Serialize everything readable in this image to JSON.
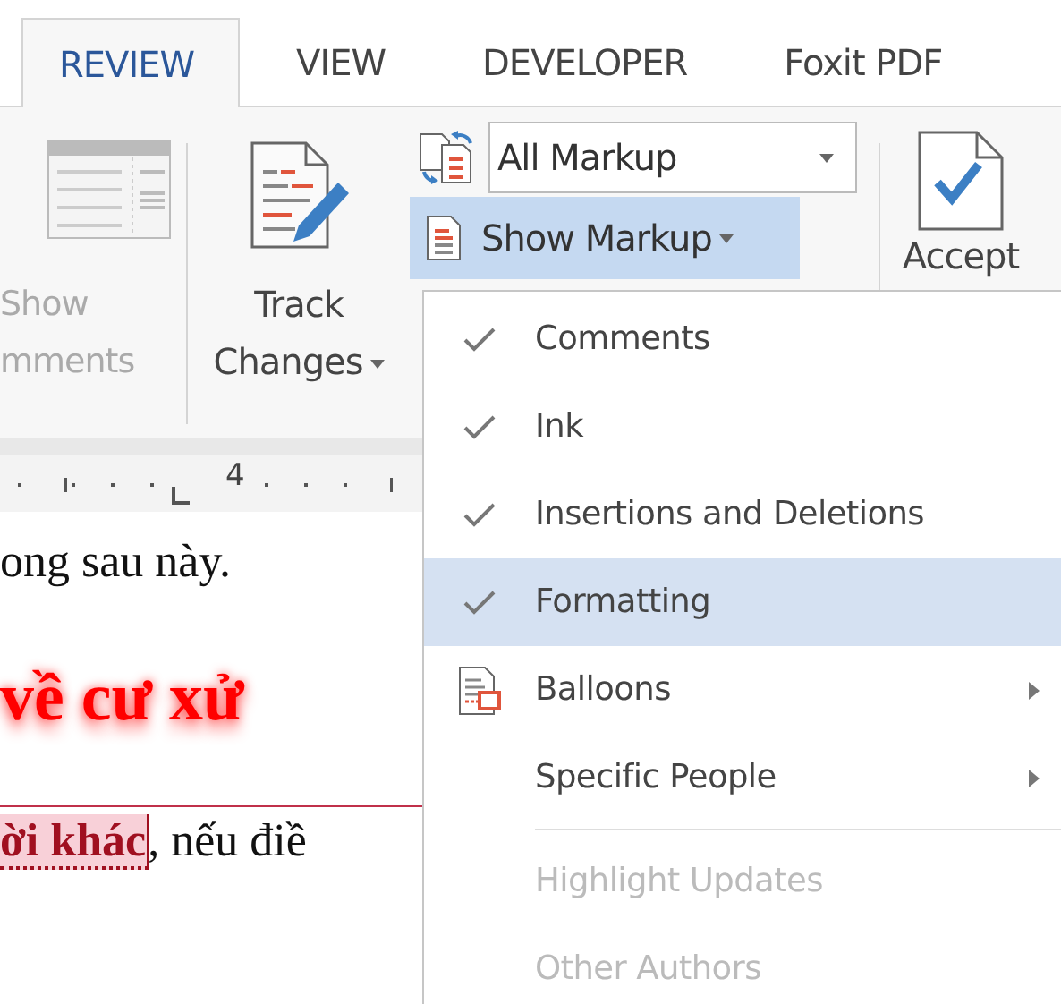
{
  "tabs": [
    {
      "label": "REVIEW",
      "selected": true
    },
    {
      "label": "VIEW",
      "selected": false
    },
    {
      "label": "DEVELOPER",
      "selected": false
    },
    {
      "label": "Foxit PDF",
      "selected": false
    }
  ],
  "ribbon": {
    "show_comments": {
      "lines": [
        "Show",
        "mments"
      ],
      "disabled": true
    },
    "track_changes": {
      "lines": [
        "Track",
        "Changes"
      ],
      "dropdown": true
    },
    "markup_select": {
      "value": "All Markup"
    },
    "show_markup": {
      "label": "Show Markup",
      "selected": true
    },
    "accept": {
      "label": "Accept"
    }
  },
  "ruler": {
    "mark": "4"
  },
  "document": {
    "lines": [
      {
        "kind": "plain",
        "parts": [
          {
            "kind": "plain",
            "text": "ong sau này."
          }
        ]
      },
      {
        "kind": "heading",
        "parts": [
          {
            "kind": "plain",
            "text": "về cư xử"
          }
        ]
      },
      {
        "kind": "tracked",
        "parts": [
          {
            "kind": "inserted",
            "text": "ời khác"
          },
          {
            "kind": "plain",
            "text": ", nếu điề"
          }
        ]
      }
    ]
  },
  "menu": {
    "items": [
      {
        "kind": "check",
        "label": "Comments",
        "checked": true,
        "selected": false,
        "disabled": false,
        "submenu": false
      },
      {
        "kind": "check",
        "label": "Ink",
        "checked": true,
        "selected": false,
        "disabled": false,
        "submenu": false
      },
      {
        "kind": "check",
        "label": "Insertions and Deletions",
        "checked": true,
        "selected": false,
        "disabled": false,
        "submenu": false
      },
      {
        "kind": "check",
        "label": "Formatting",
        "checked": true,
        "selected": true,
        "disabled": false,
        "submenu": false
      },
      {
        "kind": "icon",
        "label": "Balloons",
        "selected": false,
        "disabled": false,
        "submenu": true
      },
      {
        "kind": "check",
        "label": "Specific People",
        "checked": false,
        "selected": false,
        "disabled": false,
        "submenu": true
      },
      {
        "kind": "separator"
      },
      {
        "kind": "check",
        "label": "Highlight Updates",
        "checked": false,
        "selected": false,
        "disabled": true,
        "submenu": false
      },
      {
        "kind": "check",
        "label": "Other Authors",
        "checked": false,
        "selected": false,
        "disabled": true,
        "submenu": false
      }
    ]
  }
}
